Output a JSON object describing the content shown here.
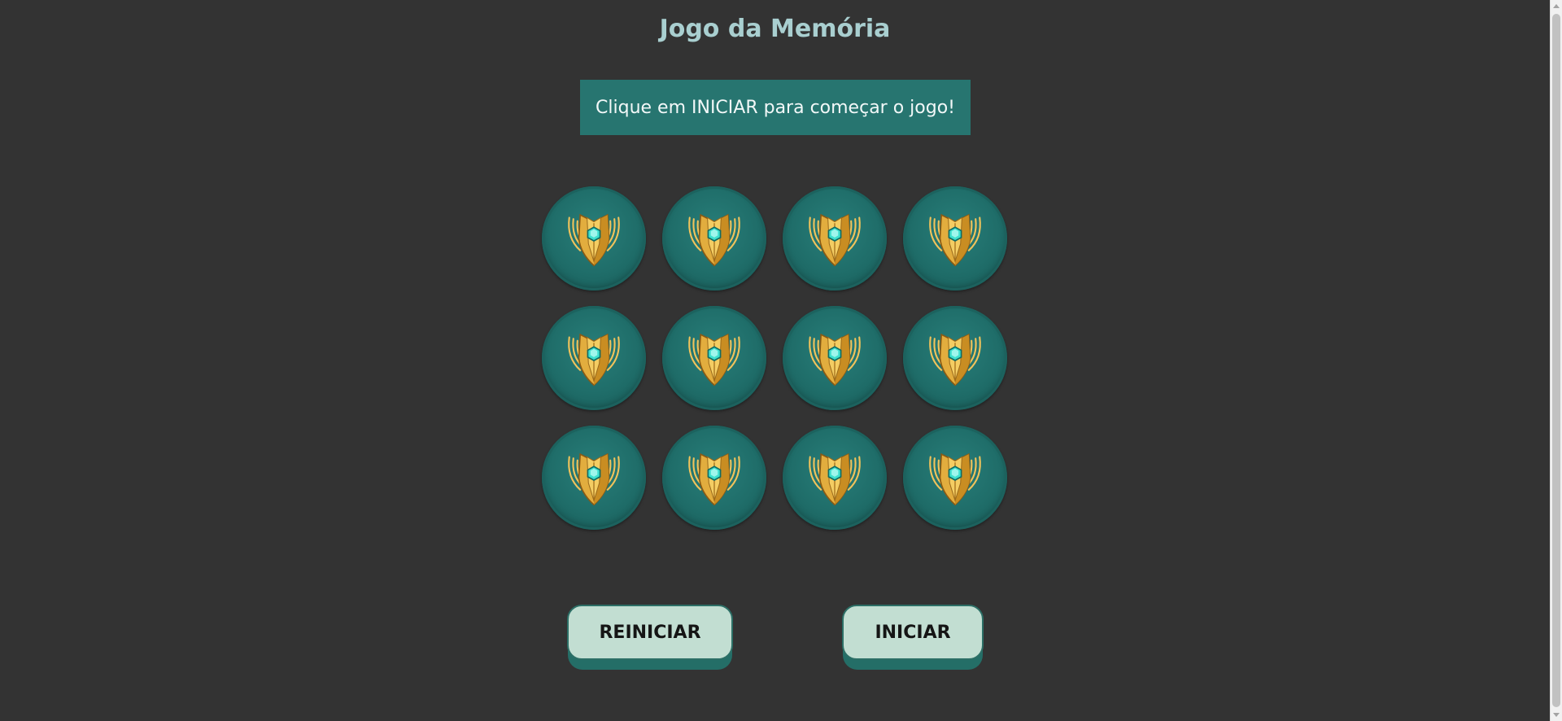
{
  "header": {
    "title": "Jogo da Memória"
  },
  "status": {
    "message": "Clique em INICIAR para começar o jogo!"
  },
  "board": {
    "rows": 3,
    "columns": 4,
    "cards": [
      {
        "icon": "mastery-emblem-icon",
        "face": "down"
      },
      {
        "icon": "mastery-emblem-icon",
        "face": "down"
      },
      {
        "icon": "mastery-emblem-icon",
        "face": "down"
      },
      {
        "icon": "mastery-emblem-icon",
        "face": "down"
      },
      {
        "icon": "mastery-emblem-icon",
        "face": "down"
      },
      {
        "icon": "mastery-emblem-icon",
        "face": "down"
      },
      {
        "icon": "mastery-emblem-icon",
        "face": "down"
      },
      {
        "icon": "mastery-emblem-icon",
        "face": "down"
      },
      {
        "icon": "mastery-emblem-icon",
        "face": "down"
      },
      {
        "icon": "mastery-emblem-icon",
        "face": "down"
      },
      {
        "icon": "mastery-emblem-icon",
        "face": "down"
      },
      {
        "icon": "mastery-emblem-icon",
        "face": "down"
      }
    ]
  },
  "controls": {
    "restart_label": "REINICIAR",
    "start_label": "INICIAR"
  },
  "colors": {
    "background": "#333333",
    "title": "#a9cfd0",
    "message_bg": "#277570",
    "card_teal": "#1f6d69",
    "button_face": "#c2ded2",
    "emblem_gold": "#e8b84a",
    "emblem_gem": "#3fe0cf"
  }
}
